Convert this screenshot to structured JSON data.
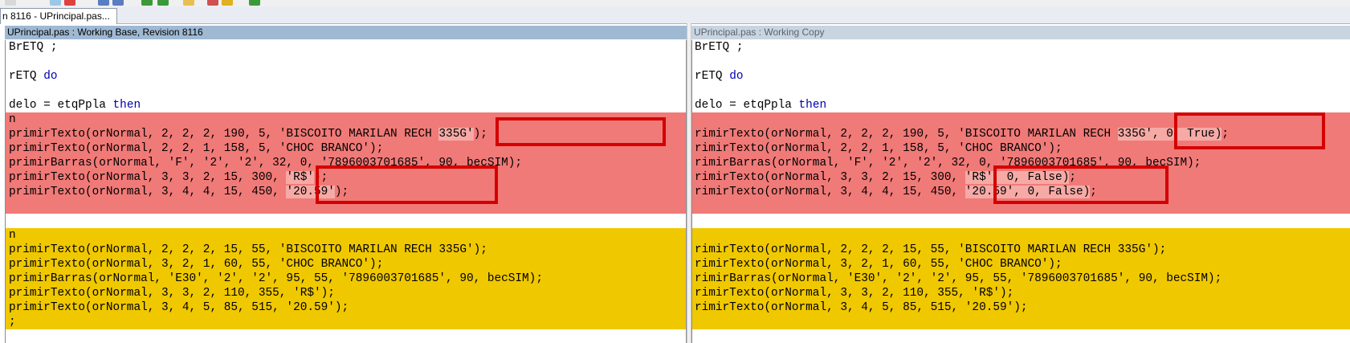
{
  "colors": {
    "deleted_block": "#f07a78",
    "changed_block": "#f0c800",
    "keyword": "#0000b0",
    "annotation_box": "#d40000"
  },
  "toolbar": {
    "icons": [
      "new-icon",
      "open-icon",
      "save-icon",
      "undo-icon",
      "redo-icon",
      "next-diff-icon",
      "prev-diff-icon",
      "folder-icon",
      "merge-icon",
      "check-icon"
    ]
  },
  "tab": {
    "label": "n 8116 - UPrincipal.pas..."
  },
  "left_pane": {
    "title": "UPrincipal.pas : Working Base, Revision 8116",
    "lines": [
      {
        "parts": [
          "BrETQ ;"
        ],
        "bg": ""
      },
      {
        "parts": [
          ""
        ],
        "bg": ""
      },
      {
        "parts": [
          "rETQ ",
          "do"
        ],
        "bg": ""
      },
      {
        "parts": [
          ""
        ],
        "bg": ""
      },
      {
        "parts": [
          "delo = etqPpla ",
          "then"
        ],
        "bg": ""
      },
      {
        "parts": [
          "n"
        ],
        "bg": "red"
      },
      {
        "parts": [
          "primirTexto(orNormal, 2, 2, 2, 190, 5, 'BISCOITO MARILAN RECH ",
          "335G'",
          ");"
        ],
        "bg": "red"
      },
      {
        "parts": [
          "primirTexto(orNormal, 2, 2, 1, 158, 5, 'CHOC BRANCO');"
        ],
        "bg": "red"
      },
      {
        "parts": [
          "primirBarras(orNormal, 'F', '2', '2', 32, 0, '7896003701685', 90, becSIM);"
        ],
        "bg": "red"
      },
      {
        "parts": [
          "primirTexto(orNormal, 3, 3, 2, 15, 300, ",
          "'R$'",
          ");"
        ],
        "bg": "red"
      },
      {
        "parts": [
          "primirTexto(orNormal, 3, 4, 4, 15, 450, ",
          "'20.59'",
          ");"
        ],
        "bg": "red"
      },
      {
        "parts": [
          ""
        ],
        "bg": "red"
      },
      {
        "parts": [
          ""
        ],
        "bg": ""
      },
      {
        "parts": [
          "n"
        ],
        "bg": "yellow"
      },
      {
        "parts": [
          "primirTexto(orNormal, 2, 2, 2, 15, 55, 'BISCOITO MARILAN RECH 335G');"
        ],
        "bg": "yellow"
      },
      {
        "parts": [
          "primirTexto(orNormal, 3, 2, 1, 60, 55, 'CHOC BRANCO');"
        ],
        "bg": "yellow"
      },
      {
        "parts": [
          "primirBarras(orNormal, 'E30', '2', '2', 95, 55, '7896003701685', 90, becSIM);"
        ],
        "bg": "yellow"
      },
      {
        "parts": [
          "primirTexto(orNormal, 3, 3, 2, 110, 355, 'R$');"
        ],
        "bg": "yellow"
      },
      {
        "parts": [
          "primirTexto(orNormal, 3, 4, 5, 85, 515, '20.59');"
        ],
        "bg": "yellow"
      },
      {
        "parts": [
          ";"
        ],
        "bg": "yellow"
      }
    ]
  },
  "right_pane": {
    "title": "UPrincipal.pas : Working Copy",
    "lines": [
      {
        "parts": [
          "BrETQ ;"
        ],
        "bg": ""
      },
      {
        "parts": [
          ""
        ],
        "bg": ""
      },
      {
        "parts": [
          "rETQ ",
          "do"
        ],
        "bg": ""
      },
      {
        "parts": [
          ""
        ],
        "bg": ""
      },
      {
        "parts": [
          "delo = etqPpla ",
          "then"
        ],
        "bg": ""
      },
      {
        "parts": [
          ""
        ],
        "bg": "red"
      },
      {
        "parts": [
          "rimirTexto(orNormal, 2, 2, 2, 190, 5, 'BISCOITO MARILAN RECH ",
          "335G', 0, True)",
          ";"
        ],
        "bg": "red"
      },
      {
        "parts": [
          "rimirTexto(orNormal, 2, 2, 1, 158, 5, 'CHOC BRANCO');"
        ],
        "bg": "red"
      },
      {
        "parts": [
          "rimirBarras(orNormal, 'F', '2', '2', 32, 0, '7896003701685', 90, becSIM);"
        ],
        "bg": "red"
      },
      {
        "parts": [
          "rimirTexto(orNormal, 3, 3, 2, 15, 300, ",
          "'R$', 0, False)",
          ";"
        ],
        "bg": "red"
      },
      {
        "parts": [
          "rimirTexto(orNormal, 3, 4, 4, 15, 450, ",
          "'20.59', 0, False)",
          ";"
        ],
        "bg": "red"
      },
      {
        "parts": [
          ""
        ],
        "bg": "red"
      },
      {
        "parts": [
          ""
        ],
        "bg": ""
      },
      {
        "parts": [
          ""
        ],
        "bg": "yellow"
      },
      {
        "parts": [
          "rimirTexto(orNormal, 2, 2, 2, 15, 55, 'BISCOITO MARILAN RECH 335G');"
        ],
        "bg": "yellow"
      },
      {
        "parts": [
          "rimirTexto(orNormal, 3, 2, 1, 60, 55, 'CHOC BRANCO');"
        ],
        "bg": "yellow"
      },
      {
        "parts": [
          "rimirBarras(orNormal, 'E30', '2', '2', 95, 55, '7896003701685', 90, becSIM);"
        ],
        "bg": "yellow"
      },
      {
        "parts": [
          "rimirTexto(orNormal, 3, 3, 2, 110, 355, 'R$');"
        ],
        "bg": "yellow"
      },
      {
        "parts": [
          "rimirTexto(orNormal, 3, 4, 5, 85, 515, '20.59');"
        ],
        "bg": "yellow"
      },
      {
        "parts": [
          ""
        ],
        "bg": "yellow"
      }
    ]
  }
}
